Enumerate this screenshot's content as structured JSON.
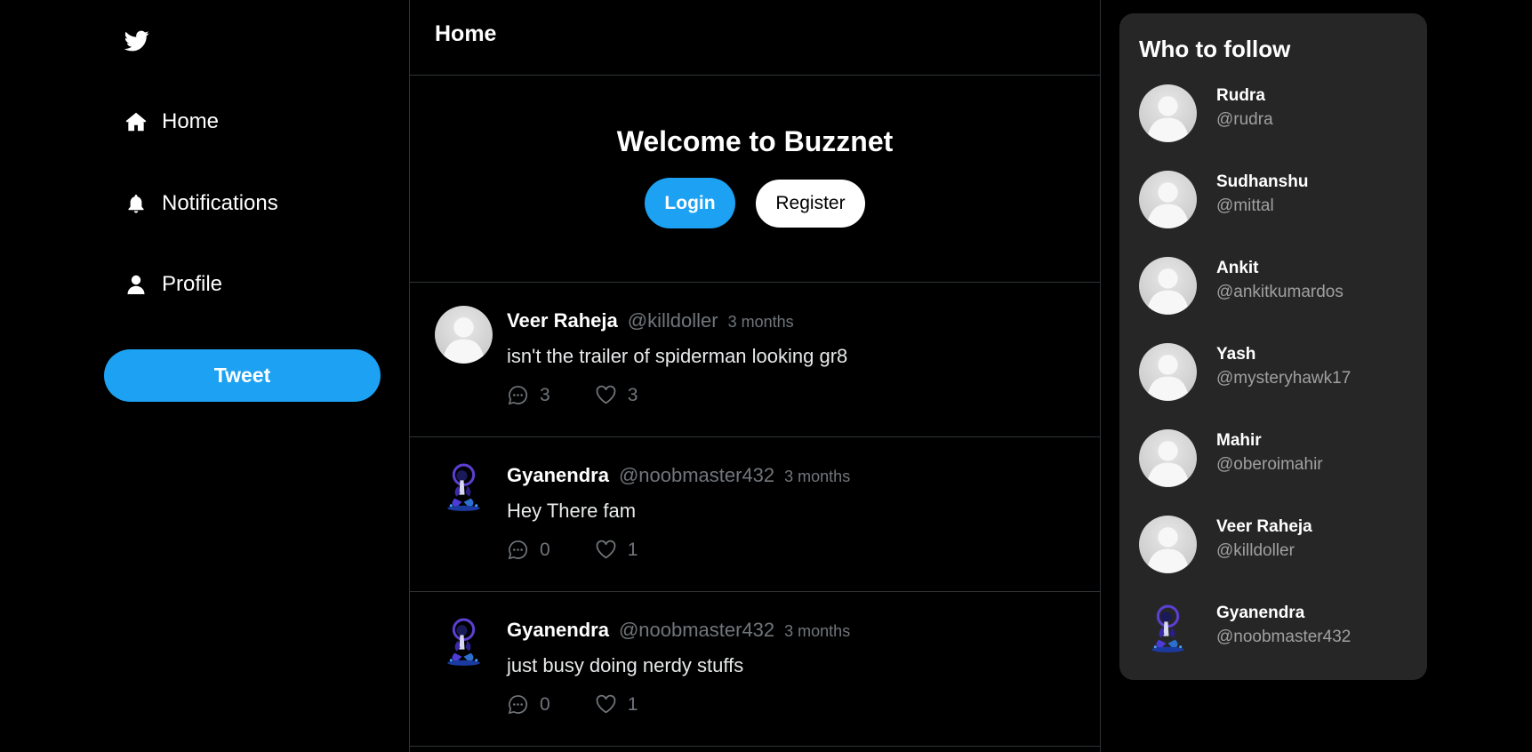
{
  "sidebar": {
    "logo_icon": "twitter-bird-icon",
    "nav": [
      {
        "label": "Home",
        "icon": "home-icon"
      },
      {
        "label": "Notifications",
        "icon": "bell-icon"
      },
      {
        "label": "Profile",
        "icon": "user-icon"
      }
    ],
    "tweet_label": "Tweet"
  },
  "header": {
    "title": "Home"
  },
  "welcome": {
    "title": "Welcome to Buzznet",
    "login_label": "Login",
    "register_label": "Register"
  },
  "posts": [
    {
      "author": "Veer Raheja",
      "handle": "@killdoller",
      "time": "3 months",
      "text": "isn't the trailer of spiderman looking gr8",
      "comments": "3",
      "likes": "3",
      "avatar": "default"
    },
    {
      "author": "Gyanendra",
      "handle": "@noobmaster432",
      "time": "3 months",
      "text": "Hey There fam",
      "comments": "0",
      "likes": "1",
      "avatar": "custom"
    },
    {
      "author": "Gyanendra",
      "handle": "@noobmaster432",
      "time": "3 months",
      "text": "just busy doing nerdy stuffs",
      "comments": "0",
      "likes": "1",
      "avatar": "custom"
    }
  ],
  "who_to_follow": {
    "title": "Who to follow",
    "users": [
      {
        "name": "Rudra",
        "handle": "@rudra",
        "avatar": "default"
      },
      {
        "name": "Sudhanshu",
        "handle": "@mittal",
        "avatar": "default"
      },
      {
        "name": "Ankit",
        "handle": "@ankitkumardos",
        "avatar": "default"
      },
      {
        "name": "Yash",
        "handle": "@mysteryhawk17",
        "avatar": "default"
      },
      {
        "name": "Mahir",
        "handle": "@oberoimahir",
        "avatar": "default"
      },
      {
        "name": "Veer Raheja",
        "handle": "@killdoller",
        "avatar": "default"
      },
      {
        "name": "Gyanendra",
        "handle": "@noobmaster432",
        "avatar": "custom"
      }
    ]
  },
  "colors": {
    "accent": "#1da1f2",
    "background": "#000000",
    "panel": "#262626",
    "muted_text": "#71767b"
  }
}
